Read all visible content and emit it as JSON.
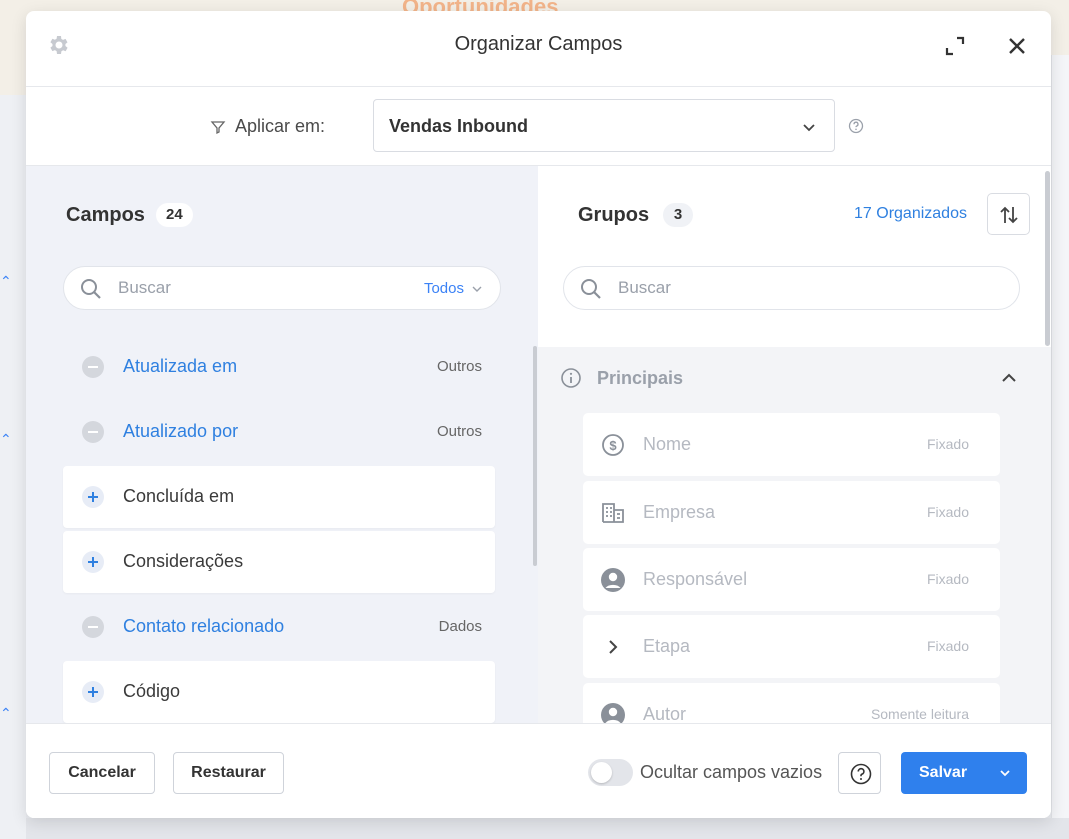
{
  "background": {
    "title": "Oportunidades"
  },
  "modal": {
    "title": "Organizar Campos",
    "apply_label": "Aplicar em:",
    "apply_value": "Vendas Inbound",
    "left": {
      "title": "Campos",
      "count": "24",
      "search_placeholder": "Buscar",
      "filter_label": "Todos",
      "fields": [
        {
          "name": "Atualizada em",
          "category": "Outros",
          "state": "used"
        },
        {
          "name": "Atualizado por",
          "category": "Outros",
          "state": "used"
        },
        {
          "name": "Concluída em",
          "category": "",
          "state": "available"
        },
        {
          "name": "Considerações",
          "category": "",
          "state": "available"
        },
        {
          "name": "Contato relacionado",
          "category": "Dados",
          "state": "used"
        },
        {
          "name": "Código",
          "category": "",
          "state": "available"
        }
      ]
    },
    "right": {
      "title": "Grupos",
      "count": "3",
      "organized_label": "17 Organizados",
      "search_placeholder": "Buscar",
      "group": {
        "name": "Principais",
        "fields": [
          {
            "name": "Nome",
            "status": "Fixado",
            "icon": "dollar-circle-icon"
          },
          {
            "name": "Empresa",
            "status": "Fixado",
            "icon": "building-icon"
          },
          {
            "name": "Responsável",
            "status": "Fixado",
            "icon": "user-circle-icon"
          },
          {
            "name": "Etapa",
            "status": "Fixado",
            "icon": "chevron-right-icon"
          },
          {
            "name": "Autor",
            "status": "Somente leitura",
            "icon": "user-circle-icon"
          }
        ]
      }
    },
    "footer": {
      "cancel_label": "Cancelar",
      "restore_label": "Restaurar",
      "hide_empty_label": "Ocultar campos vazios",
      "hide_empty_on": false,
      "save_label": "Salvar"
    }
  },
  "colors": {
    "accent": "#2f80ed",
    "link": "#2f80e0"
  }
}
